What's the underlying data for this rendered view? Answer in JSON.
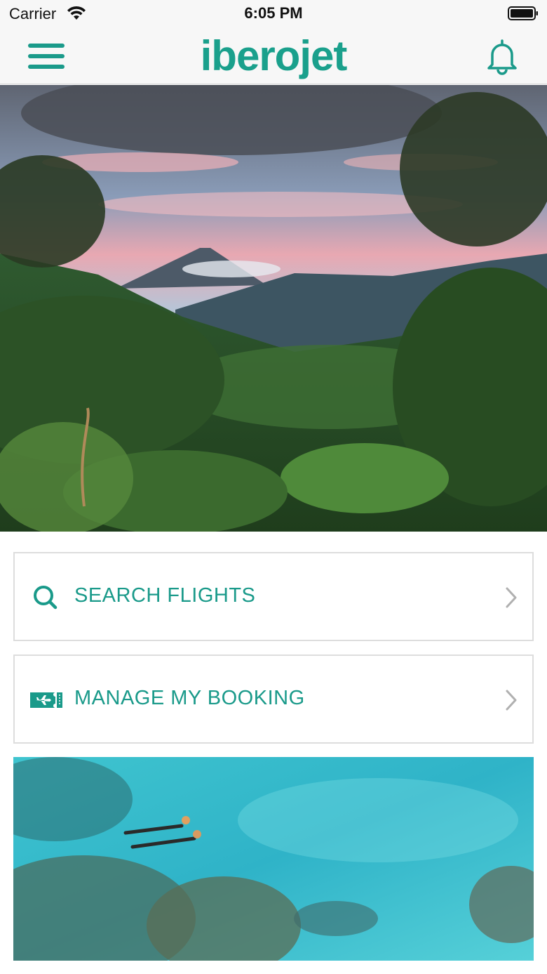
{
  "status_bar": {
    "carrier": "Carrier",
    "time": "6:05 PM"
  },
  "header": {
    "logo_text": "iberojet",
    "brand_color": "#1a9a8a",
    "menu_icon": "hamburger-menu-icon",
    "notifications_icon": "bell-icon"
  },
  "hero": {
    "description_icon": "hero-image"
  },
  "actions": [
    {
      "label": "SEARCH FLIGHTS",
      "icon": "search-icon"
    },
    {
      "label": "MANAGE MY BOOKING",
      "icon": "ticket-plane-icon"
    }
  ],
  "promo": {
    "icon": "promo-image"
  }
}
